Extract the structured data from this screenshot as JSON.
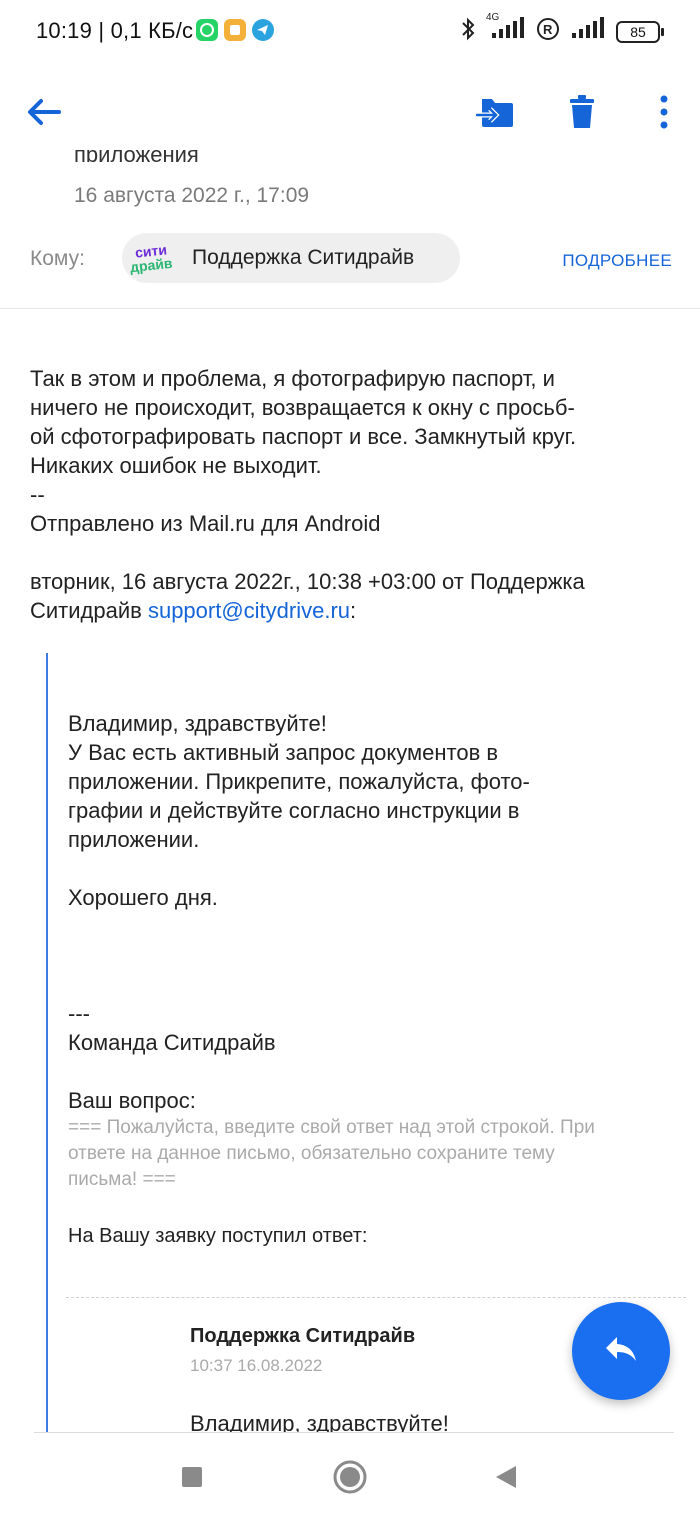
{
  "status_bar": {
    "time_speed": "10:19 | 0,1 КБ/с",
    "network": "4G",
    "battery": "85",
    "icons": [
      "whatsapp-icon",
      "notes-app-icon",
      "telegram-icon",
      "bluetooth-icon",
      "signal-icon",
      "registered-icon",
      "signal-icon"
    ]
  },
  "toolbar": {
    "icons": [
      "back-arrow-icon",
      "move-to-folder-icon",
      "trash-icon",
      "more-vert-icon"
    ],
    "accent": "#1565d8"
  },
  "header": {
    "subject_partial": "приложения",
    "date": "16 августа 2022 г., 17:09",
    "to_label": "Кому:",
    "recipient": {
      "logo_line1": "сити",
      "logo_line2": "драйв",
      "name": "Поддержка Ситидрайв"
    },
    "more_label": "ПОДРОБНЕЕ"
  },
  "body": {
    "lines": [
      "Так в этом и проблема, я фотографирую паспорт, и",
      "ничего не происходит, возвращается к окну с просьб-",
      "ой сфотографировать паспорт и все. Замкнутый круг.",
      "Никаких ошибок не выходит.",
      "--",
      "Отправлено из Mail.ru для Android"
    ],
    "quote_header_line1": "вторник, 16 августа 2022г., 10:38 +03:00 от Поддержка",
    "quote_header_line2_prefix": "Ситидрайв ",
    "quote_email": "support@citydrive.ru",
    "quote_header_suffix": ":"
  },
  "quote": {
    "greeting": "Владимир, здравствуйте!",
    "lines": [
      "У Вас есть активный запрос документов в",
      "приложении. Прикрепите, пожалуйста, фото-",
      "графии и действуйте согласно инструкции в",
      "приложении."
    ],
    "good_day": "Хорошего дня.",
    "separator": "---",
    "team": "Команда Ситидрайв",
    "your_question": "Ваш вопрос:",
    "gray_lines": [
      "=== Пожалуйста, введите свой ответ над этой строкой. При",
      "ответе на данное письмо, обязательно сохраните тему",
      "письма! ==="
    ],
    "answer_received": "На Вашу заявку поступил ответ:",
    "inner_sender": "Поддержка Ситидрайв",
    "inner_time": "10:37 16.08.2022",
    "inner_greeting": "Владимир, здравствуйте!"
  },
  "fab": {
    "icon": "reply-icon",
    "color": "#1a6ff0"
  },
  "nav": {
    "icons": [
      "recents-square-icon",
      "home-circle-icon",
      "back-triangle-icon"
    ]
  }
}
